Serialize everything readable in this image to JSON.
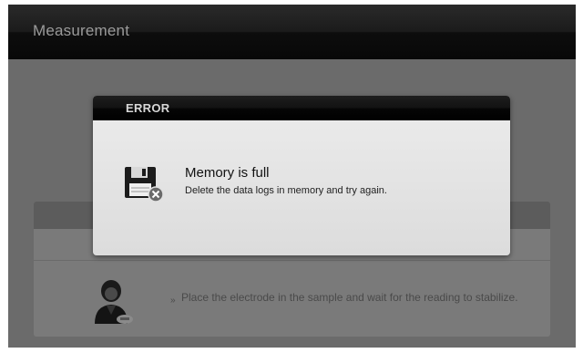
{
  "app": {
    "title": "Measurement"
  },
  "dialog": {
    "title": "ERROR",
    "message_title": "Memory is full",
    "message_detail": "Delete the data logs in memory and try again.",
    "icon": "floppy-disk-error-icon"
  },
  "background_panel": {
    "instruction": "Place the electrode in the sample and wait for the reading to stabilize.",
    "bullet": "»",
    "icon": "person-icon"
  }
}
